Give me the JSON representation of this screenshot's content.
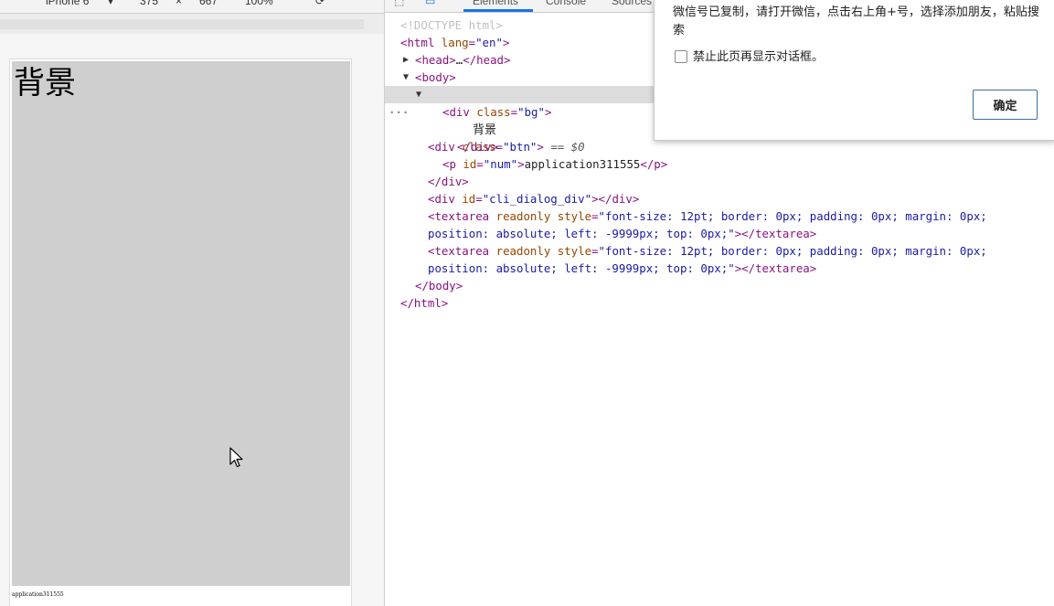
{
  "device_toolbar": {
    "device_name": "iPhone 6",
    "width": "375",
    "separator": "×",
    "height": "667",
    "zoom": "100%"
  },
  "viewport": {
    "bg_text": "背景",
    "num_text": "application311555"
  },
  "devtools": {
    "tabs": [
      "Elements",
      "Console",
      "Sources"
    ],
    "active_tab": "Elements",
    "dom": {
      "doctype": "<!DOCTYPE html>",
      "html_open_tag": "html",
      "html_lang_attr": "lang",
      "html_lang_val": "\"en\"",
      "head_tag": "<head>",
      "head_ellipsis": "…",
      "head_close": "</head>",
      "body_open": "<body>",
      "div_btn_open": "<div",
      "div_btn_attr": "class",
      "div_btn_val": "\"btn\"",
      "div_btn_close_bracket": ">",
      "selected_marker": " == $0",
      "div_bg_open": "<div",
      "div_bg_attr": "class",
      "div_bg_val": "\"bg\"",
      "div_bg_close_bracket": ">",
      "bg_text": "背景",
      "div_close": "</div>",
      "p_open": "<p",
      "p_attr": "id",
      "p_val": "\"num\"",
      "p_text": "application311555",
      "p_close": "</p>",
      "div_btn_close": "</div>",
      "dialog_div_open": "<div",
      "dialog_div_attr": "id",
      "dialog_div_val": "\"cli_dialog_div\"",
      "dialog_div_close": "></div>",
      "textarea_open": "<textarea",
      "textarea_attr_readonly": "readonly",
      "textarea_attr_style": "style",
      "textarea_style_val_1": "\"font-size: 12pt; border: 0px; padding: 0px; margin: 0px;",
      "textarea_style_val_2": "position: absolute; left: -9999px; top: 0px;\"",
      "textarea_close": "></textarea>",
      "body_close": "</body>",
      "html_close": "</html>"
    }
  },
  "dialog": {
    "message": "微信号已复制，请打开微信，点击右上角+号，选择添加朋友，粘贴搜索",
    "checkbox_label": "禁止此页再显示对话框。",
    "ok_label": "确定"
  }
}
